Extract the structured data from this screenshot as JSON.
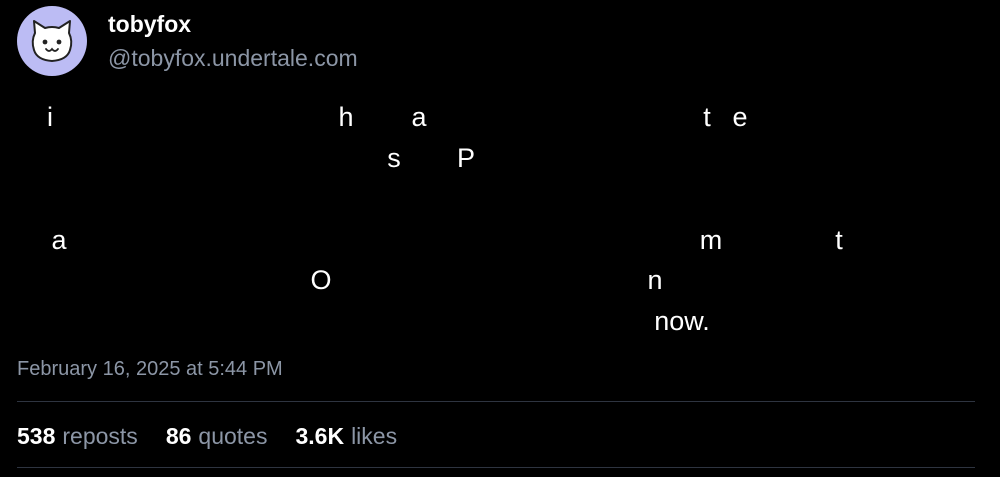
{
  "author": {
    "display_name": "tobyfox",
    "handle": "@tobyfox.undertale.com",
    "avatar_icon": "white-cat-face-icon",
    "avatar_bg": "#bcbcf4"
  },
  "post": {
    "text_lines": [
      {
        "chars": [
          "i",
          "h",
          "a",
          "t",
          "e"
        ]
      },
      {
        "chars": [
          "s",
          "P"
        ]
      },
      {
        "chars": [
          "a",
          "m",
          "t"
        ]
      },
      {
        "chars": [
          "O",
          "n"
        ]
      },
      {
        "chars": [
          "now."
        ]
      }
    ],
    "timestamp": "February 16, 2025 at 5:44 PM"
  },
  "stats": [
    {
      "count": "538",
      "label": "reposts"
    },
    {
      "count": "86",
      "label": "quotes"
    },
    {
      "count": "3.6K",
      "label": "likes"
    }
  ],
  "colors": {
    "background": "#000000",
    "text": "#ffffff",
    "muted": "#8c96a6",
    "divider": "#2e3440"
  }
}
